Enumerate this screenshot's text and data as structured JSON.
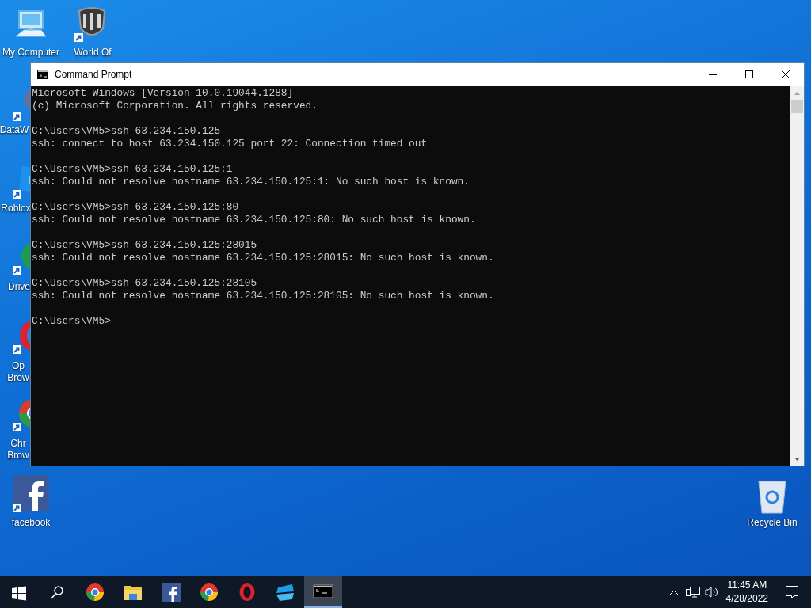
{
  "desktop_icons": [
    {
      "kind": "computer",
      "lines": [
        "My Computer"
      ],
      "shortcut": false
    },
    {
      "kind": "tanks",
      "lines": [
        "World Of"
      ],
      "shortcut": true
    },
    {
      "kind": "dataw",
      "lines": [
        "DataW"
      ],
      "shortcut": true
    },
    {
      "kind": "roblox",
      "lines": [
        "Roblox"
      ],
      "shortcut": true
    },
    {
      "kind": "drive",
      "lines": [
        "Drive"
      ],
      "shortcut": true
    },
    {
      "kind": "opera",
      "lines": [
        "Op",
        "Brow"
      ],
      "shortcut": true
    },
    {
      "kind": "chrome",
      "lines": [
        "Chr",
        "Brow"
      ],
      "shortcut": true
    },
    {
      "kind": "facebook",
      "lines": [
        "facebook"
      ],
      "shortcut": true
    },
    {
      "kind": "recycle",
      "lines": [
        "Recycle Bin"
      ],
      "shortcut": false
    }
  ],
  "window": {
    "title": "Command Prompt",
    "console_blocks": [
      [
        "Microsoft Windows [Version 10.0.19044.1288]",
        "(c) Microsoft Corporation. All rights reserved."
      ],
      [
        "C:\\Users\\VM5>ssh 63.234.150.125",
        "ssh: connect to host 63.234.150.125 port 22: Connection timed out"
      ],
      [
        "C:\\Users\\VM5>ssh 63.234.150.125:1",
        "ssh: Could not resolve hostname 63.234.150.125:1: No such host is known."
      ],
      [
        "C:\\Users\\VM5>ssh 63.234.150.125:80",
        "ssh: Could not resolve hostname 63.234.150.125:80: No such host is known."
      ],
      [
        "C:\\Users\\VM5>ssh 63.234.150.125:28015",
        "ssh: Could not resolve hostname 63.234.150.125:28015: No such host is known."
      ],
      [
        "C:\\Users\\VM5>ssh 63.234.150.125:28105",
        "ssh: Could not resolve hostname 63.234.150.125:28105: No such host is known."
      ],
      [
        "C:\\Users\\VM5>"
      ]
    ]
  },
  "taskbar": {
    "items": [
      {
        "kind": "start",
        "selected": false
      },
      {
        "kind": "search",
        "selected": false
      },
      {
        "kind": "chrome",
        "selected": false
      },
      {
        "kind": "explorer",
        "selected": false
      },
      {
        "kind": "facebook",
        "selected": false
      },
      {
        "kind": "chrome",
        "selected": false
      },
      {
        "kind": "opera",
        "selected": false
      },
      {
        "kind": "blueapp",
        "selected": false
      },
      {
        "kind": "cmd",
        "selected": true
      }
    ],
    "time": "11:45 AM",
    "date": "4/28/2022"
  }
}
